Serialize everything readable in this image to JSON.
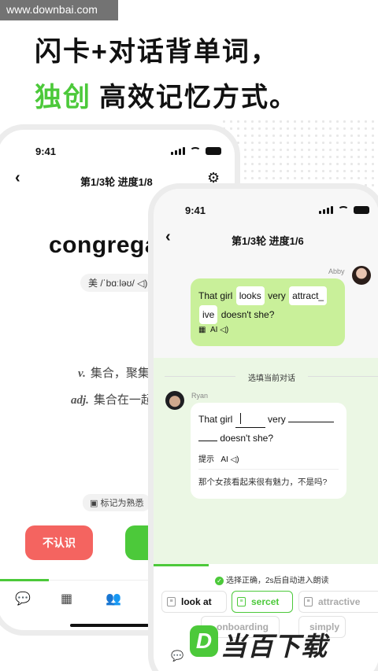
{
  "watermark": "www.downbai.com",
  "headline": {
    "line1": "闪卡+对话背单词，",
    "accent": "独创",
    "line2": "高效记忆方式。"
  },
  "phone1": {
    "time": "9:41",
    "nav_title": "第1/3轮  进度1/8",
    "word": "congregate",
    "phonetic": "美 /ˈbɑːləʊ/ ◁)",
    "definitions": [
      {
        "pos": "v.",
        "text": "集合，聚集"
      },
      {
        "pos": "adj.",
        "text": "集合在一起的"
      }
    ],
    "mark_label": "标记为熟悉",
    "unknown_label": "不认识",
    "tabs": [
      "chat-icon",
      "grid-icon",
      "people-icon"
    ]
  },
  "phone2": {
    "time": "9:41",
    "nav_title": "第1/3轮  进度1/6",
    "abby": {
      "name": "Abby",
      "w1": "That girl",
      "w2": "looks",
      "w3": "very",
      "w4": "attract_",
      "w5": "ive",
      "w6": "doesn't she?",
      "ai": "AI ◁)"
    },
    "section_title": "选填当前对话",
    "ryan": {
      "name": "Ryan",
      "line1a": "That girl",
      "line1b": "very",
      "line2": "doesn't she?",
      "hint": "提示",
      "ai": "AI ◁)",
      "translation": "那个女孩看起来很有魅力，不是吗?"
    },
    "feedback": "选择正确，2s后自动进入朗读",
    "options": [
      {
        "label": "look at",
        "state": "normal"
      },
      {
        "label": "sercet",
        "state": "selected"
      },
      {
        "label": "attractive",
        "state": "dim"
      },
      {
        "label": "onboarding",
        "state": "dim"
      },
      {
        "label": "simply",
        "state": "dim"
      }
    ]
  },
  "brand": {
    "logo_letter": "D",
    "name": "当百下载"
  },
  "colors": {
    "accent": "#4cc93a",
    "danger": "#f46460",
    "bubble": "#c9f09a"
  }
}
